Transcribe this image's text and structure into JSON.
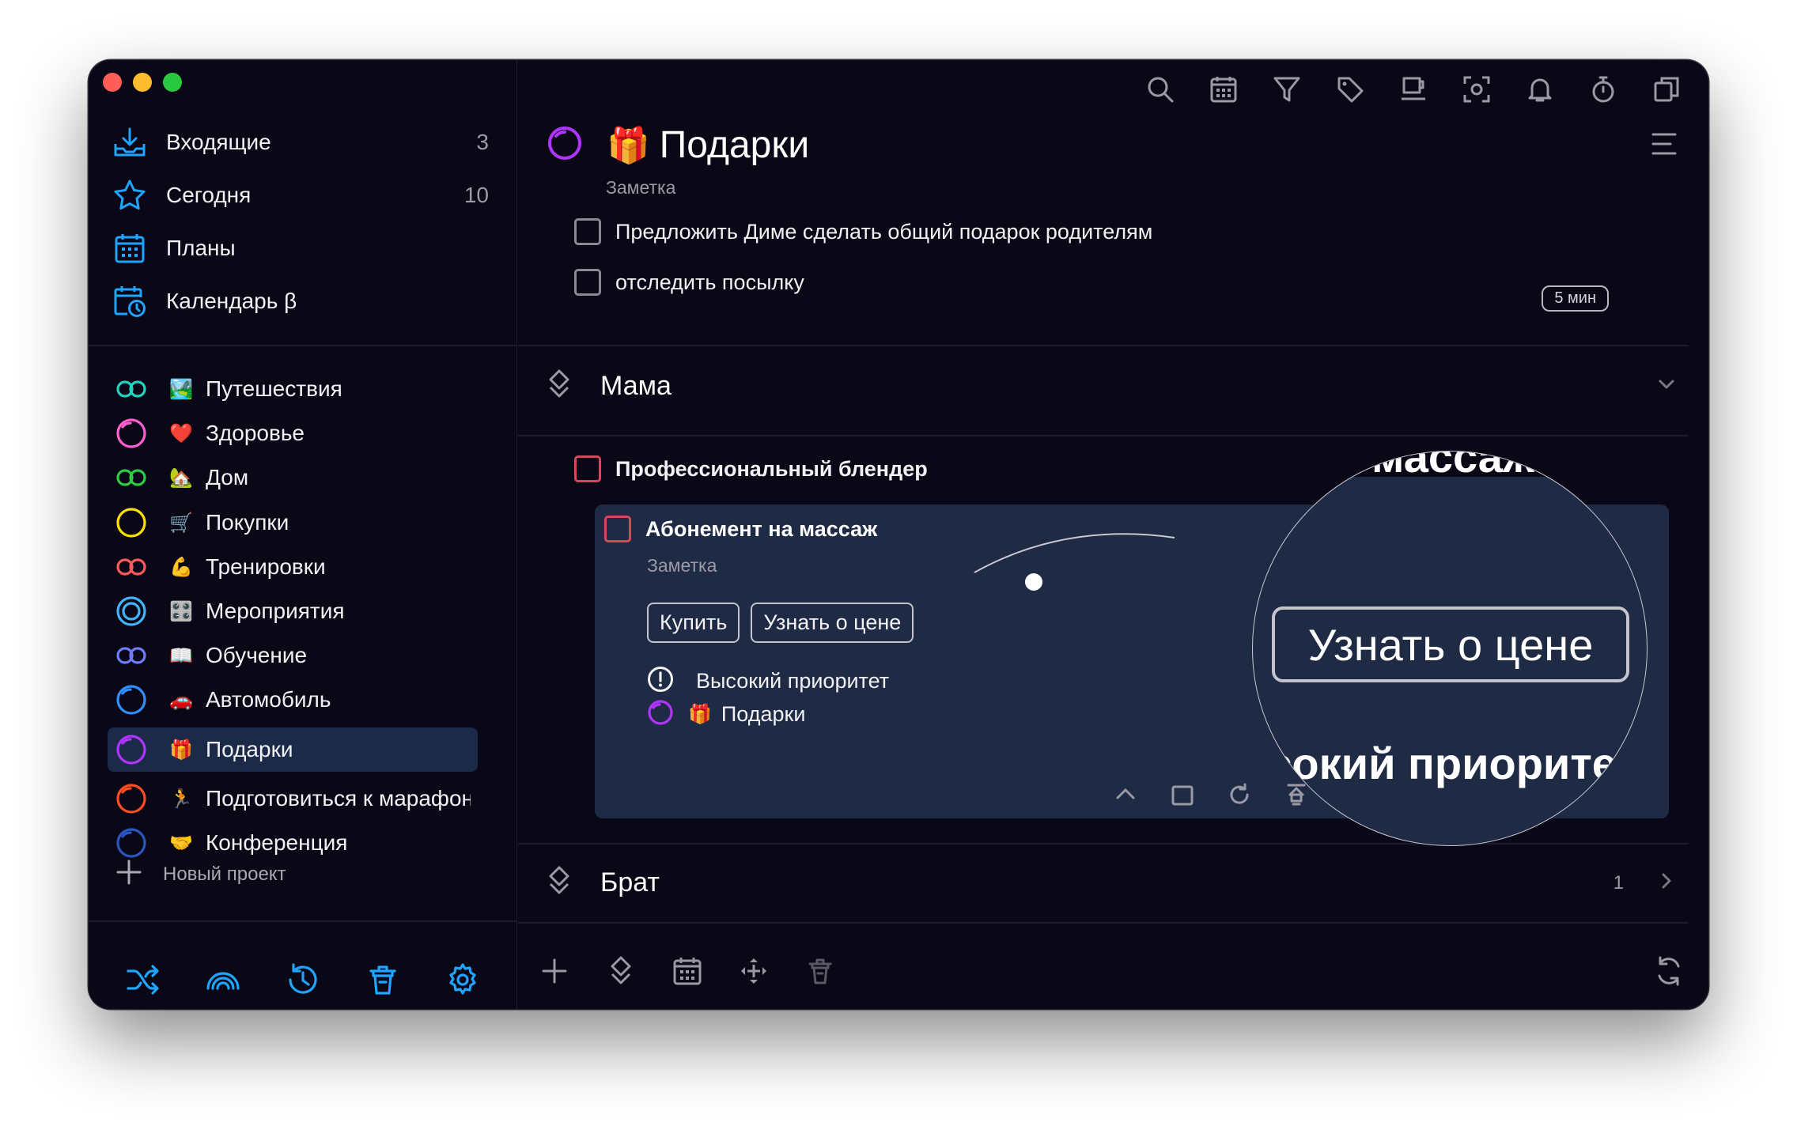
{
  "sidebar": {
    "nav": [
      {
        "label": "Входящие",
        "count": "3",
        "icon": "inbox-icon"
      },
      {
        "label": "Сегодня",
        "count": "10",
        "icon": "star-icon"
      },
      {
        "label": "Планы",
        "count": "",
        "icon": "calendar-grid-icon"
      },
      {
        "label": "Календарь β",
        "count": "",
        "icon": "calendar-clock-icon"
      }
    ],
    "projects": [
      {
        "label": "Путешествия",
        "emoji": "🏞️",
        "ring_color": "#23d3c1"
      },
      {
        "label": "Здоровье",
        "emoji": "❤️",
        "ring_color": "#ff5fd0"
      },
      {
        "label": "Дом",
        "emoji": "🏡",
        "ring_color": "#2ecc40"
      },
      {
        "label": "Покупки",
        "emoji": "🛒",
        "ring_color": "#ffe000"
      },
      {
        "label": "Тренировки",
        "emoji": "💪",
        "ring_color": "#ff5a5a"
      },
      {
        "label": "Мероприятия",
        "emoji": "🎛️",
        "ring_color": "#3fb5ff"
      },
      {
        "label": "Обучение",
        "emoji": "📖",
        "ring_color": "#6f7bff"
      },
      {
        "label": "Автомобиль",
        "emoji": "🚗",
        "ring_color": "#2f8fff"
      },
      {
        "label": "Подарки",
        "emoji": "🎁",
        "ring_color": "#b133ff"
      },
      {
        "label": "Подготовиться к марафону",
        "emoji": "🏃",
        "ring_color": "#ff4d1f"
      },
      {
        "label": "Конференция",
        "emoji": "🤝",
        "ring_color": "#2a56c2"
      }
    ],
    "new_project_label": "Новый проект",
    "bottom_icons": [
      "shuffle-icon",
      "rainbow-icon",
      "history-icon",
      "trash-icon",
      "settings-icon"
    ]
  },
  "main": {
    "title": "Подарки",
    "title_emoji": "🎁",
    "subtitle": "Заметка",
    "tasks": [
      {
        "text": "Предложить Диме сделать общий подарок родителям"
      },
      {
        "text": "отследить посылку",
        "badge": "5 мин"
      }
    ],
    "groups": {
      "mama": {
        "name": "Мама"
      },
      "brat": {
        "name": "Брат",
        "count": "1"
      }
    },
    "mama_tasks": [
      {
        "text": "Профессиональный блендер"
      }
    ],
    "detail": {
      "title": "Абонемент на массаж",
      "note": "Заметка",
      "buttons": [
        "Купить",
        "Узнать о цене"
      ],
      "priority_label": "Высокий приоритет",
      "project_emoji": "🎁",
      "project_label": "Подарки"
    },
    "magnifier": {
      "top_text": "массаж",
      "button_text": "Узнать о цене",
      "priority_text": "Высокий приоритет"
    }
  },
  "colors": {
    "bg": "#0a0716",
    "accent": "#1fa5ff",
    "detail_bg": "#1f2a45",
    "active_item": "#1c2a4a",
    "checkbox_red": "#d9475c"
  }
}
